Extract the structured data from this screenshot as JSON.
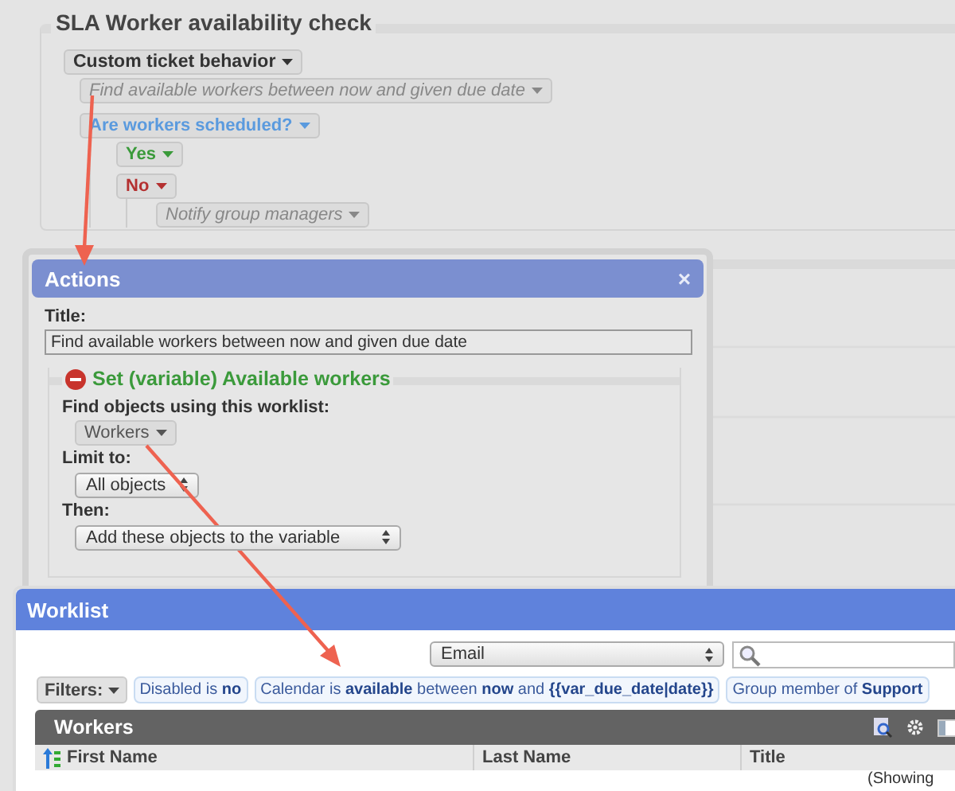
{
  "workflow": {
    "legend": "SLA Worker availability check",
    "trigger": "Custom ticket behavior",
    "nodes": [
      {
        "kind": "action",
        "label": "Find available workers between now and given due date"
      },
      {
        "kind": "condition",
        "label": "Are workers scheduled?",
        "children": [
          {
            "kind": "yes",
            "label": "Yes"
          },
          {
            "kind": "no",
            "label": "No",
            "children": [
              {
                "kind": "action",
                "label": "Notify group managers"
              }
            ]
          }
        ]
      }
    ]
  },
  "actions_dialog": {
    "title": "Actions",
    "close": "×",
    "title_label": "Title:",
    "title_value": "Find available workers between now and given due date",
    "section": {
      "legend": "Set (variable) Available workers",
      "find_label": "Find objects using this worklist:",
      "worklist": "Workers",
      "limit_label": "Limit to:",
      "limit_value": "All objects",
      "then_label": "Then:",
      "then_value": "Add these objects to the variable"
    }
  },
  "worklist_window": {
    "title": "Worklist",
    "type_select": "Email",
    "filters_button": "Filters:",
    "filters": [
      "Disabled is **no**",
      "Calendar is **available** between **now** and **{{var_due_date|date}}**",
      "Group member of **Support**"
    ],
    "table": {
      "title": "Workers",
      "columns": [
        {
          "label": "First Name",
          "sorted": true
        },
        {
          "label": "Last Name",
          "sorted": false
        },
        {
          "label": "Title",
          "sorted": false
        }
      ],
      "footer": "(Showing"
    }
  }
}
